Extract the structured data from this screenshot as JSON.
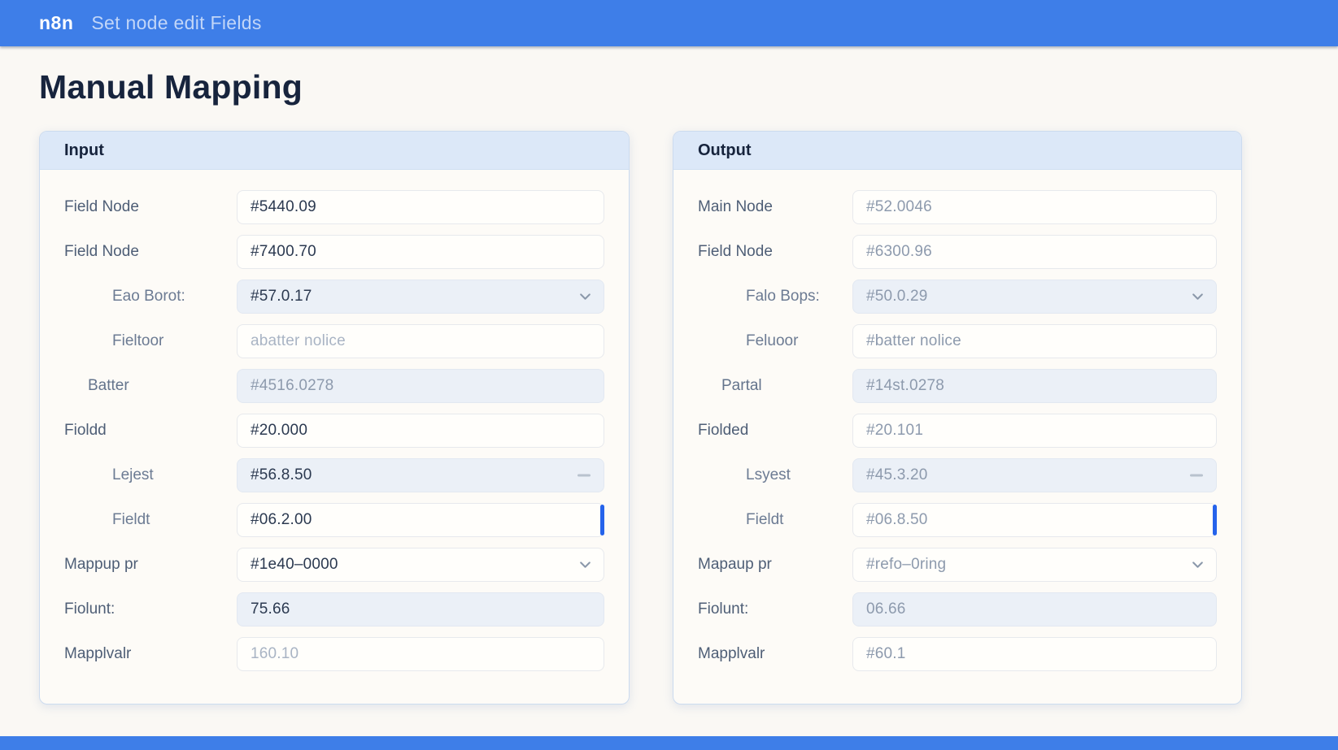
{
  "header": {
    "brand": "n8n",
    "title": "Set node edit Fields"
  },
  "page": {
    "title": "Manual Mapping"
  },
  "colors": {
    "accent_blue": "#3e7ee8",
    "focus_blue": "#2563eb",
    "panel_header_bg": "#dce8f8",
    "title_navy": "#17243d",
    "field_gray_bg": "#ebf0f7"
  },
  "icons": {
    "select_chevron": "chevron-down-icon",
    "stepper_dash": "minus-icon",
    "focus_caret": "focus-caret"
  },
  "panels": [
    {
      "id": "input",
      "title": "Input",
      "rows": [
        {
          "label": "Field Node",
          "value": "#5440.09",
          "type": "text",
          "tone": "dark",
          "indent": 0
        },
        {
          "label": "Field Node",
          "value": "#7400.70",
          "type": "text",
          "tone": "dark",
          "indent": 0
        },
        {
          "label": "Eao Borot:",
          "value": "#57.0.17",
          "type": "select",
          "bg": "gray",
          "tone": "dark",
          "indent": 2
        },
        {
          "label": "Fieltoor",
          "value": "abatter nolice",
          "type": "text",
          "tone": "faint",
          "indent": 2
        },
        {
          "label": "Batter",
          "value": "#4516.0278",
          "type": "disabled",
          "tone": "muted",
          "indent": 1
        },
        {
          "label": "Fioldd",
          "value": "#20.000",
          "type": "text",
          "tone": "dark",
          "indent": 0
        },
        {
          "label": "Lejest",
          "value": "#56.8.50",
          "type": "stepper",
          "tone": "dark",
          "indent": 2
        },
        {
          "label": "Fieldt",
          "value": "#06.2.00",
          "type": "focus",
          "tone": "dark",
          "indent": 2
        },
        {
          "label": "Mappup pr",
          "value": "#1e40–0000",
          "type": "select",
          "bg": "white",
          "tone": "dark",
          "indent": 0
        },
        {
          "label": "Fiolunt:",
          "value": "75.66",
          "type": "disabled",
          "tone": "dark",
          "indent": 0
        },
        {
          "label": "Mapplvalr",
          "value": "160.10",
          "type": "text",
          "tone": "faint",
          "indent": 0
        }
      ]
    },
    {
      "id": "output",
      "title": "Output",
      "rows": [
        {
          "label": "Main Node",
          "value": "#52.0046",
          "type": "text",
          "tone": "muted",
          "indent": 0
        },
        {
          "label": "Field Node",
          "value": "#6300.96",
          "type": "text",
          "tone": "muted",
          "indent": 0
        },
        {
          "label": "Falo Bops:",
          "value": "#50.0.29",
          "type": "select",
          "bg": "gray",
          "tone": "muted",
          "indent": 2
        },
        {
          "label": "Feluoor",
          "value": "#batter nolice",
          "type": "text",
          "tone": "muted",
          "indent": 2
        },
        {
          "label": "Partal",
          "value": "#14st.0278",
          "type": "disabled",
          "tone": "muted",
          "indent": 1
        },
        {
          "label": "Fiolded",
          "value": "#20.101",
          "type": "text",
          "tone": "muted",
          "indent": 0
        },
        {
          "label": "Lsyest",
          "value": "#45.3.20",
          "type": "stepper",
          "tone": "muted",
          "indent": 2
        },
        {
          "label": "Fieldt",
          "value": "#06.8.50",
          "type": "focus",
          "tone": "muted",
          "indent": 2
        },
        {
          "label": "Mapaup pr",
          "value": "#refo–0ring",
          "type": "select",
          "bg": "white",
          "tone": "muted",
          "indent": 0
        },
        {
          "label": "Fiolunt:",
          "value": "06.66",
          "type": "disabled",
          "tone": "muted",
          "indent": 0
        },
        {
          "label": "Mapplvalr",
          "value": "#60.1",
          "type": "text",
          "tone": "muted",
          "indent": 0
        }
      ]
    }
  ]
}
